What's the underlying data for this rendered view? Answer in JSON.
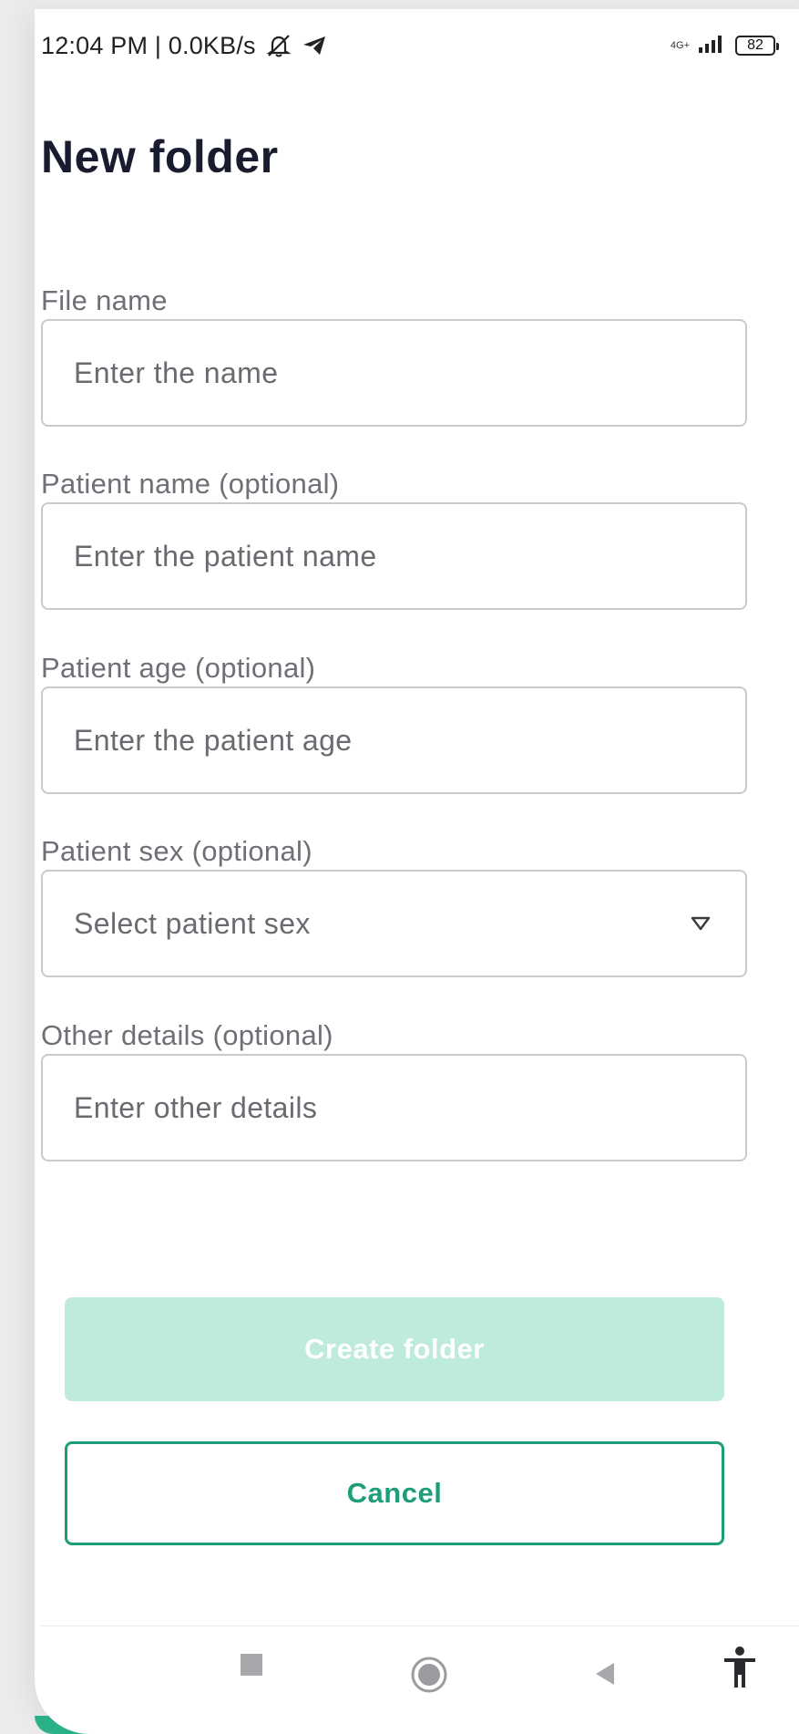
{
  "status_bar": {
    "time_text": "12:04 PM | 0.0KB/s",
    "network_text": "4G+",
    "battery_level": "82"
  },
  "page": {
    "title": "New folder"
  },
  "form": {
    "file_name": {
      "label": "File name",
      "placeholder": "Enter the name"
    },
    "patient_name": {
      "label": "Patient name (optional)",
      "placeholder": "Enter the patient name"
    },
    "patient_age": {
      "label": "Patient age (optional)",
      "placeholder": "Enter the patient age"
    },
    "patient_sex": {
      "label": "Patient sex (optional)",
      "placeholder": "Select patient sex"
    },
    "other_details": {
      "label": "Other details (optional)",
      "placeholder": "Enter other details"
    }
  },
  "actions": {
    "create_label": "Create folder",
    "cancel_label": "Cancel"
  },
  "colors": {
    "accent": "#1d9e78",
    "create_disabled_bg": "#bfeade",
    "title_color": "#181c2e"
  },
  "nav_icons": [
    "recents-square-icon",
    "home-circle-icon",
    "back-triangle-icon",
    "accessibility-icon"
  ]
}
